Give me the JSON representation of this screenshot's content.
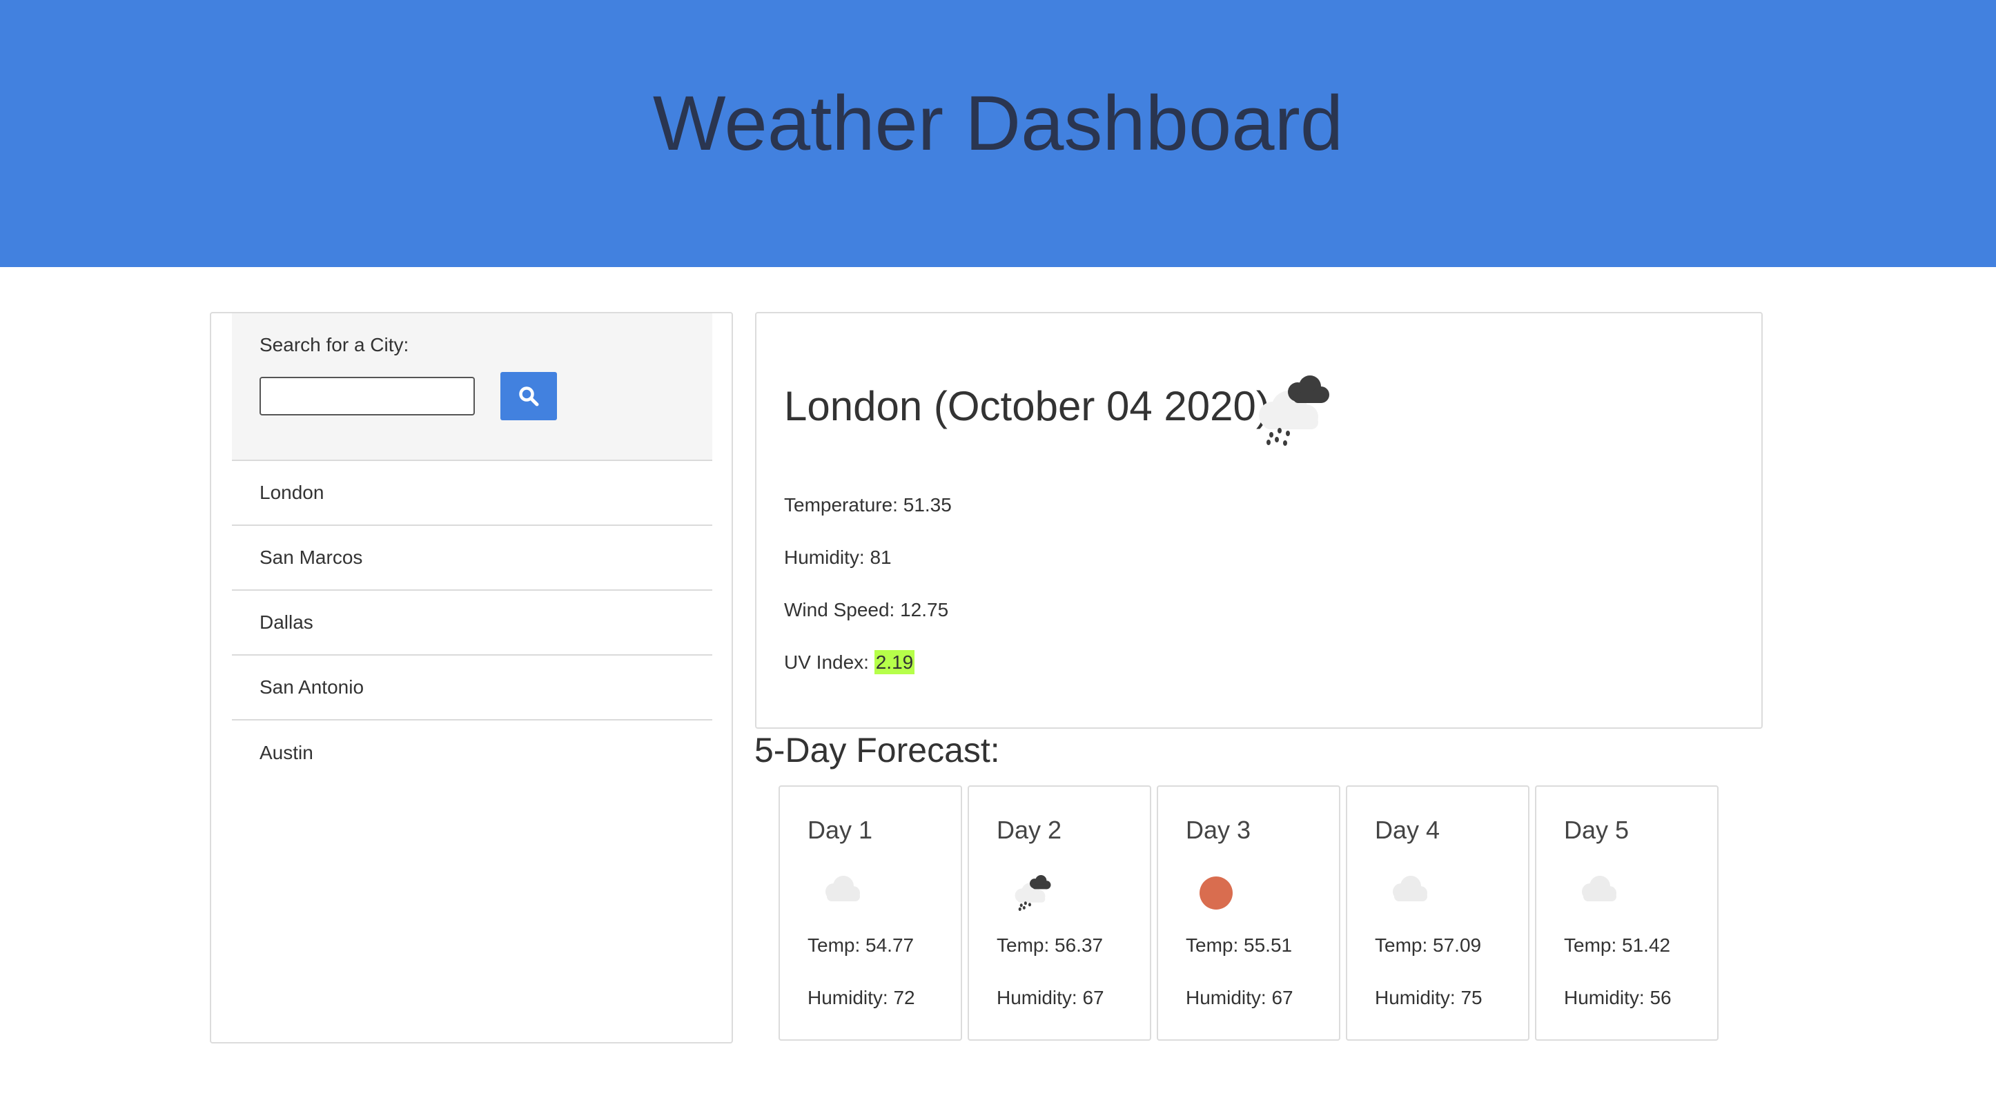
{
  "header": {
    "title": "Weather Dashboard"
  },
  "sidebar": {
    "search_label": "Search for a City:",
    "search_value": "",
    "search_button_icon": "search-icon",
    "cities": [
      "London",
      "San Marcos",
      "Dallas",
      "San Antonio",
      "Austin"
    ]
  },
  "current": {
    "title": "London (October 04 2020)",
    "icon": "rain-cloud-icon",
    "temperature": "Temperature: 51.35",
    "humidity": "Humidity: 81",
    "wind_speed": "Wind Speed: 12.75",
    "uv_label": "UV Index: ",
    "uv_value": "2.19",
    "uv_color": "#b6ff4a"
  },
  "forecast": {
    "heading": "5-Day Forecast:",
    "days": [
      {
        "label": "Day 1",
        "icon": "cloud-icon",
        "temp": "Temp: 54.77",
        "humidity": "Humidity: 72"
      },
      {
        "label": "Day 2",
        "icon": "rain-cloud-icon",
        "temp": "Temp: 56.37",
        "humidity": "Humidity: 67"
      },
      {
        "label": "Day 3",
        "icon": "sun-icon",
        "temp": "Temp: 55.51",
        "humidity": "Humidity: 67"
      },
      {
        "label": "Day 4",
        "icon": "cloud-icon",
        "temp": "Temp: 57.09",
        "humidity": "Humidity: 75"
      },
      {
        "label": "Day 5",
        "icon": "cloud-icon",
        "temp": "Temp: 51.42",
        "humidity": "Humidity: 56"
      }
    ]
  },
  "colors": {
    "header": "#4281df",
    "accent": "#4281df",
    "sun": "#d96d4f"
  }
}
